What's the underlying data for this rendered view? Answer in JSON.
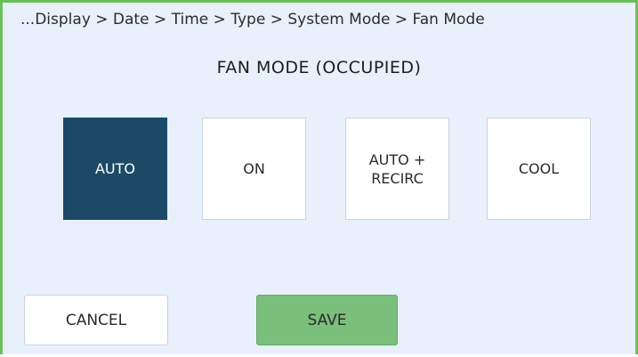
{
  "breadcrumb": "...Display > Date > Time > Type > System Mode > Fan Mode",
  "title": "FAN MODE (OCCUPIED)",
  "modes": [
    {
      "label": "AUTO",
      "selected": true
    },
    {
      "label": "ON",
      "selected": false
    },
    {
      "label": "AUTO +\nRECIRC",
      "selected": false
    },
    {
      "label": "COOL",
      "selected": false
    }
  ],
  "buttons": {
    "cancel": "CANCEL",
    "save": "SAVE"
  },
  "colors": {
    "selected_bg": "#1c4a66",
    "save_bg": "#7abf7b",
    "border_green": "#6bbf59",
    "screen_bg": "#e8f1fb"
  }
}
